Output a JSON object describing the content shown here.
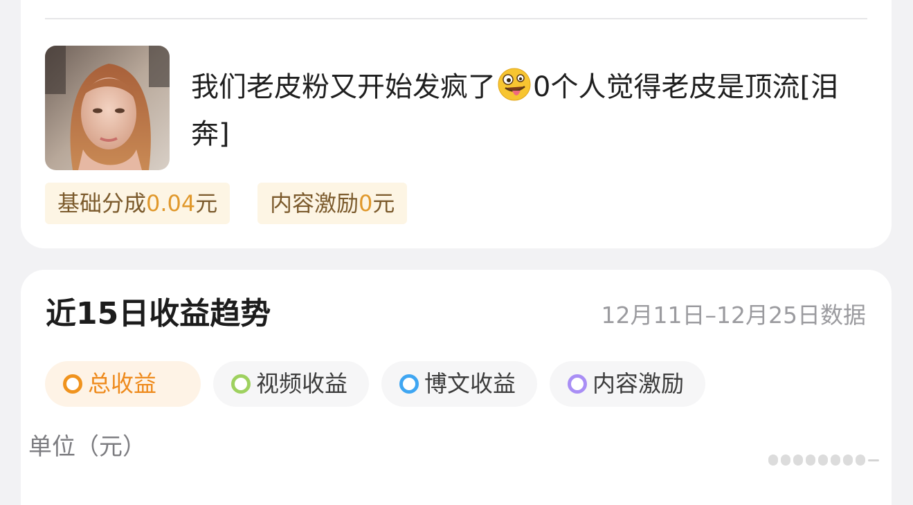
{
  "post": {
    "text_part1": "我们老皮粉又开始发疯了",
    "emoji": "zany-face",
    "text_part2": "0个人觉得老皮是顶流[泪奔]",
    "chips": [
      {
        "label": "基础分成",
        "value": "0.04",
        "unit": "元"
      },
      {
        "label": "内容激励",
        "value": "0",
        "unit": "元"
      }
    ]
  },
  "trend": {
    "title": "近15日收益趋势",
    "date_range": "12月11日–12月25日数据",
    "tabs": [
      {
        "label": "总收益",
        "color": "#f0931e",
        "active": true
      },
      {
        "label": "视频收益",
        "color": "#9ed15f",
        "active": false
      },
      {
        "label": "博文收益",
        "color": "#3fa6f2",
        "active": false
      },
      {
        "label": "内容激励",
        "color": "#a98ef5",
        "active": false
      }
    ],
    "unit_label": "单位（元）"
  },
  "colors": {
    "accent": "#ee8a1c",
    "background": "#f2f2f4",
    "chip_background": "#fdf5e4"
  }
}
